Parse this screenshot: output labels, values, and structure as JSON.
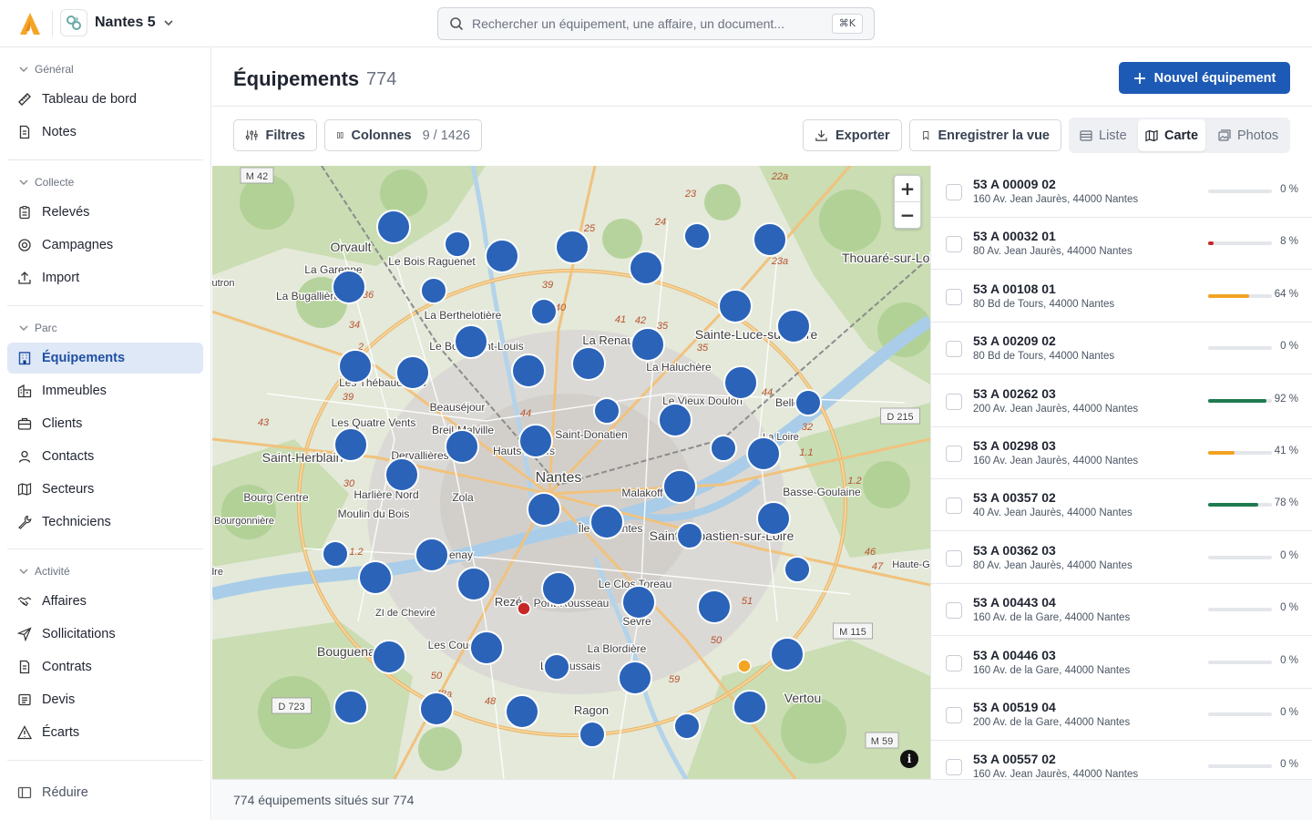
{
  "topbar": {
    "org_name": "Nantes 5",
    "search_placeholder": "Rechercher un équipement, une affaire, un document...",
    "search_shortcut": "⌘K"
  },
  "sidebar": {
    "sections": [
      {
        "title": "Général",
        "items": [
          {
            "label": "Tableau de bord",
            "icon": "ruler-icon"
          },
          {
            "label": "Notes",
            "icon": "document-icon"
          }
        ]
      },
      {
        "title": "Collecte",
        "items": [
          {
            "label": "Relevés",
            "icon": "clipboard-icon"
          },
          {
            "label": "Campagnes",
            "icon": "target-icon"
          },
          {
            "label": "Import",
            "icon": "upload-icon"
          }
        ]
      },
      {
        "title": "Parc",
        "items": [
          {
            "label": "Équipements",
            "icon": "building-icon",
            "active": true
          },
          {
            "label": "Immeubles",
            "icon": "buildings-icon"
          },
          {
            "label": "Clients",
            "icon": "briefcase-icon"
          },
          {
            "label": "Contacts",
            "icon": "user-icon"
          },
          {
            "label": "Secteurs",
            "icon": "map-icon"
          },
          {
            "label": "Techniciens",
            "icon": "wrench-icon"
          }
        ]
      },
      {
        "title": "Activité",
        "items": [
          {
            "label": "Affaires",
            "icon": "handshake-icon"
          },
          {
            "label": "Sollicitations",
            "icon": "send-icon"
          },
          {
            "label": "Contrats",
            "icon": "document-icon"
          },
          {
            "label": "Devis",
            "icon": "receipt-icon"
          },
          {
            "label": "Écarts",
            "icon": "warning-icon"
          }
        ]
      }
    ],
    "collapse_label": "Réduire"
  },
  "header": {
    "title": "Équipements",
    "count": "774",
    "new_button": "Nouvel équipement"
  },
  "toolbar": {
    "filters_label": "Filtres",
    "columns_label": "Colonnes",
    "columns_count": "9 / 1426",
    "export_label": "Exporter",
    "save_view_label": "Enregistrer la vue",
    "views": [
      {
        "label": "Liste",
        "icon": "list-icon",
        "active": false
      },
      {
        "label": "Carte",
        "icon": "map-icon",
        "active": true
      },
      {
        "label": "Photos",
        "icon": "photos-icon",
        "active": false
      }
    ]
  },
  "map": {
    "zoom_in": "+",
    "zoom_out": "−",
    "info": "i",
    "place_labels": [
      "M 42",
      "Orvault",
      "Le Bois Raguenet",
      "La Garenne",
      "La Bugallière",
      "La Berthelotière",
      "Le Bois Saint-Louis",
      "La Renaudière",
      "La Haluchère",
      "Sainte-Luce-sur-Loire",
      "Thouaré-sur-Loire",
      "Les Thébaudières",
      "Beauséjour",
      "Le Vieux Doulon",
      "Bellevue",
      "Les Quatre Vents",
      "Breil-Malville",
      "Saint-Donatien",
      "Hauts Pavés",
      "Saint-Herblain",
      "Dervallières",
      "Nantes",
      "Malakoff",
      "Basse-Goulaine",
      "Bourg Centre",
      "Harlière Nord",
      "Zola",
      "Moulin du Bois",
      "Île de Nantes",
      "Saint-Sébastien-sur-Loire",
      "Chantenay",
      "Le Clos Toreau",
      "Rezé",
      "Pont-Rousseau",
      "Sèvre",
      "Bouguenais",
      "Les Couëts",
      "La Blordière",
      "La Houssais",
      "Ragon",
      "Vertou",
      "D 215",
      "D 723",
      "M 115",
      "M 59",
      "ZI de Cheviré",
      "Haute-G",
      "La Loire",
      "Bourgonnière",
      "utron",
      "dre"
    ],
    "road_numbers": [
      "22a",
      "23",
      "25",
      "24",
      "23a",
      "36",
      "39",
      "40",
      "41",
      "42",
      "35",
      "35",
      "34",
      "2",
      "39",
      "43",
      "44",
      "44",
      "32",
      "1.1",
      "30",
      "1.2",
      "1.2",
      "46",
      "47",
      "51",
      "50",
      "50",
      "48a",
      "48",
      "59"
    ],
    "marker_status": {
      "blue": "#2a63b8",
      "red": "#c62828",
      "orange": "#f5a524"
    }
  },
  "equipments": [
    {
      "code": "53 A 00009 02",
      "address": "160 Av. Jean Jaurès, 44000 Nantes",
      "progress": 0,
      "progress_label": "0 %",
      "color": "#d1d5db"
    },
    {
      "code": "53 A 00032 01",
      "address": "80 Av. Jean Jaurès, 44000 Nantes",
      "progress": 8,
      "progress_label": "8 %",
      "color": "#c62828"
    },
    {
      "code": "53 A 00108 01",
      "address": "80 Bd de Tours, 44000 Nantes",
      "progress": 64,
      "progress_label": "64 %",
      "color": "#f2a321"
    },
    {
      "code": "53 A 00209 02",
      "address": "80 Bd de Tours, 44000 Nantes",
      "progress": 0,
      "progress_label": "0 %",
      "color": "#d1d5db"
    },
    {
      "code": "53 A 00262 03",
      "address": "200 Av. Jean Jaurès, 44000 Nantes",
      "progress": 92,
      "progress_label": "92 %",
      "color": "#1e7b4f"
    },
    {
      "code": "53 A 00298 03",
      "address": "160 Av. Jean Jaurès, 44000 Nantes",
      "progress": 41,
      "progress_label": "41 %",
      "color": "#f2a321"
    },
    {
      "code": "53 A 00357 02",
      "address": "40 Av. Jean Jaurès, 44000 Nantes",
      "progress": 78,
      "progress_label": "78 %",
      "color": "#1e7b4f"
    },
    {
      "code": "53 A 00362 03",
      "address": "80 Av. Jean Jaurès, 44000 Nantes",
      "progress": 0,
      "progress_label": "0 %",
      "color": "#d1d5db"
    },
    {
      "code": "53 A 00443 04",
      "address": "160 Av. de la Gare, 44000 Nantes",
      "progress": 0,
      "progress_label": "0 %",
      "color": "#d1d5db"
    },
    {
      "code": "53 A 00446 03",
      "address": "160 Av. de la Gare, 44000 Nantes",
      "progress": 0,
      "progress_label": "0 %",
      "color": "#d1d5db"
    },
    {
      "code": "53 A 00519 04",
      "address": "200 Av. de la Gare, 44000 Nantes",
      "progress": 0,
      "progress_label": "0 %",
      "color": "#d1d5db"
    },
    {
      "code": "53 A 00557 02",
      "address": "160 Av. Jean Jaurès, 44000 Nantes",
      "progress": 0,
      "progress_label": "0 %",
      "color": "#d1d5db"
    }
  ],
  "footer": {
    "summary": "774 équipements situés sur 774"
  },
  "colors": {
    "accent": "#1d5ab5",
    "active_nav_bg": "#dfe8f6"
  }
}
